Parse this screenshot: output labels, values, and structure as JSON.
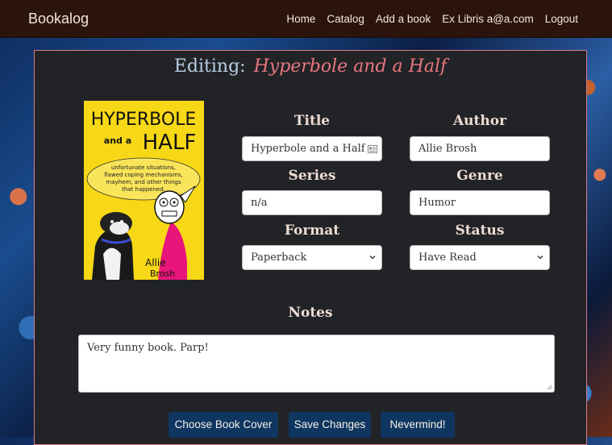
{
  "app": {
    "name": "Bookalog"
  },
  "nav": {
    "home": "Home",
    "catalog": "Catalog",
    "add_book": "Add a book",
    "ex_libris": "Ex Libris a@a.com",
    "logout": "Logout"
  },
  "page": {
    "editing_label": "Editing:",
    "book_title": "Hyperbole and a Half"
  },
  "cover": {
    "title_top": "HYPERBOLE",
    "title_and": "and a",
    "title_half": "HALF",
    "subtitle_1": "unfortunate situations,",
    "subtitle_2": "flawed coping mechanisms,",
    "subtitle_3": "mayhem, and other things",
    "subtitle_4": "that happened.",
    "author_1": "Allie",
    "author_2": "Brosh"
  },
  "form": {
    "title_label": "Title",
    "title_value": "Hyperbole and a Half",
    "author_label": "Author",
    "author_value": "Allie Brosh",
    "series_label": "Series",
    "series_value": "n/a",
    "genre_label": "Genre",
    "genre_value": "Humor",
    "format_label": "Format",
    "format_value": "Paperback",
    "status_label": "Status",
    "status_value": "Have Read",
    "notes_label": "Notes",
    "notes_value": "Very funny book. Parp!"
  },
  "buttons": {
    "choose_cover": "Choose Book Cover",
    "save": "Save Changes",
    "nevermind": "Nevermind!"
  },
  "colors": {
    "navbar": "#2a140b",
    "panel": "#222327",
    "panel_border": "#d97a8a",
    "button": "#0f3660",
    "title_accent": "#e8777f",
    "label_blue": "#b7cde4"
  }
}
